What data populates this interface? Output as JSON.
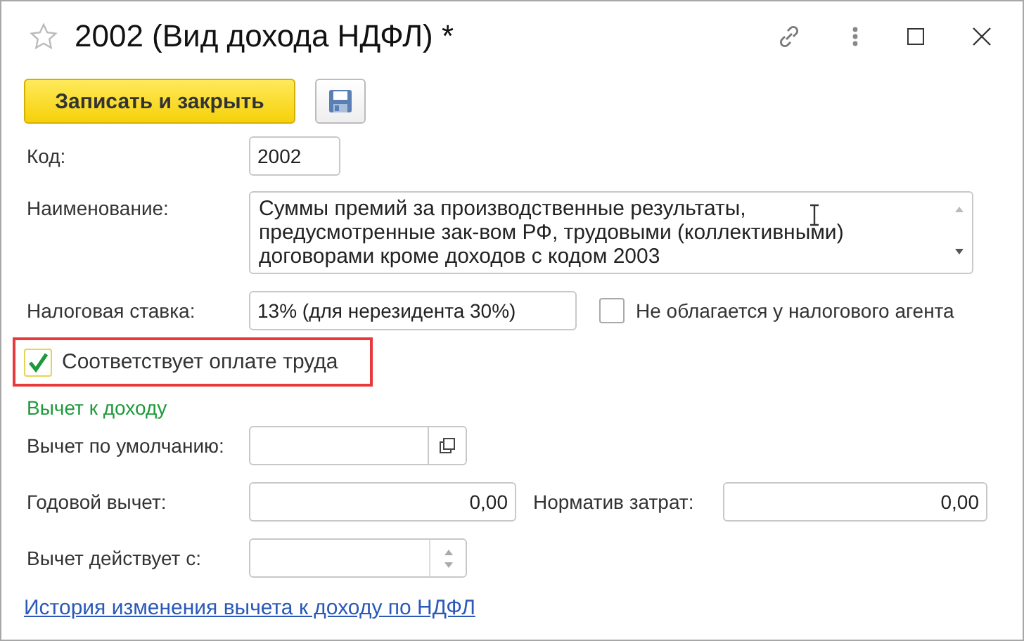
{
  "window": {
    "title": "2002 (Вид дохода НДФЛ) *"
  },
  "toolbar": {
    "save_close_button": "Записать и закрыть"
  },
  "code": {
    "label": "Код:",
    "value": "2002"
  },
  "name": {
    "label": "Наименование:",
    "value": "Суммы премий за производственные результаты, предусмотренные зак-вом РФ, трудовыми (коллективными) договорами кроме доходов с кодом 2003"
  },
  "tax_rate": {
    "label": "Налоговая ставка:",
    "value": "13% (для нерезидента 30%)"
  },
  "not_taxed_by_agent": {
    "label": "Не облагается у налогового агента",
    "checked": false
  },
  "labor_payment": {
    "label": "Соответствует оплате труда",
    "checked": true,
    "highlighted": true
  },
  "deduction_section": {
    "title": "Вычет к доходу"
  },
  "default_deduction": {
    "label": "Вычет по умолчанию:"
  },
  "annual_deduction": {
    "label": "Годовой вычет:",
    "value": "0,00"
  },
  "cost_norm": {
    "label": "Норматив затрат:",
    "value": "0,00"
  },
  "deduction_from": {
    "label": "Вычет действует с:"
  },
  "history_link": "История изменения вычета к доходу по НДФЛ"
}
